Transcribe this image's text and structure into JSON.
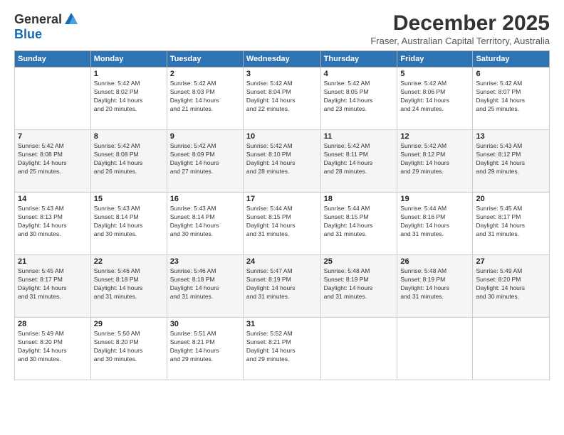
{
  "logo": {
    "general": "General",
    "blue": "Blue"
  },
  "title": "December 2025",
  "subtitle": "Fraser, Australian Capital Territory, Australia",
  "days_of_week": [
    "Sunday",
    "Monday",
    "Tuesday",
    "Wednesday",
    "Thursday",
    "Friday",
    "Saturday"
  ],
  "weeks": [
    [
      {
        "day": "",
        "info": ""
      },
      {
        "day": "1",
        "info": "Sunrise: 5:42 AM\nSunset: 8:02 PM\nDaylight: 14 hours\nand 20 minutes."
      },
      {
        "day": "2",
        "info": "Sunrise: 5:42 AM\nSunset: 8:03 PM\nDaylight: 14 hours\nand 21 minutes."
      },
      {
        "day": "3",
        "info": "Sunrise: 5:42 AM\nSunset: 8:04 PM\nDaylight: 14 hours\nand 22 minutes."
      },
      {
        "day": "4",
        "info": "Sunrise: 5:42 AM\nSunset: 8:05 PM\nDaylight: 14 hours\nand 23 minutes."
      },
      {
        "day": "5",
        "info": "Sunrise: 5:42 AM\nSunset: 8:06 PM\nDaylight: 14 hours\nand 24 minutes."
      },
      {
        "day": "6",
        "info": "Sunrise: 5:42 AM\nSunset: 8:07 PM\nDaylight: 14 hours\nand 25 minutes."
      }
    ],
    [
      {
        "day": "7",
        "info": "Sunrise: 5:42 AM\nSunset: 8:08 PM\nDaylight: 14 hours\nand 25 minutes."
      },
      {
        "day": "8",
        "info": "Sunrise: 5:42 AM\nSunset: 8:08 PM\nDaylight: 14 hours\nand 26 minutes."
      },
      {
        "day": "9",
        "info": "Sunrise: 5:42 AM\nSunset: 8:09 PM\nDaylight: 14 hours\nand 27 minutes."
      },
      {
        "day": "10",
        "info": "Sunrise: 5:42 AM\nSunset: 8:10 PM\nDaylight: 14 hours\nand 28 minutes."
      },
      {
        "day": "11",
        "info": "Sunrise: 5:42 AM\nSunset: 8:11 PM\nDaylight: 14 hours\nand 28 minutes."
      },
      {
        "day": "12",
        "info": "Sunrise: 5:42 AM\nSunset: 8:12 PM\nDaylight: 14 hours\nand 29 minutes."
      },
      {
        "day": "13",
        "info": "Sunrise: 5:43 AM\nSunset: 8:12 PM\nDaylight: 14 hours\nand 29 minutes."
      }
    ],
    [
      {
        "day": "14",
        "info": "Sunrise: 5:43 AM\nSunset: 8:13 PM\nDaylight: 14 hours\nand 30 minutes."
      },
      {
        "day": "15",
        "info": "Sunrise: 5:43 AM\nSunset: 8:14 PM\nDaylight: 14 hours\nand 30 minutes."
      },
      {
        "day": "16",
        "info": "Sunrise: 5:43 AM\nSunset: 8:14 PM\nDaylight: 14 hours\nand 30 minutes."
      },
      {
        "day": "17",
        "info": "Sunrise: 5:44 AM\nSunset: 8:15 PM\nDaylight: 14 hours\nand 31 minutes."
      },
      {
        "day": "18",
        "info": "Sunrise: 5:44 AM\nSunset: 8:15 PM\nDaylight: 14 hours\nand 31 minutes."
      },
      {
        "day": "19",
        "info": "Sunrise: 5:44 AM\nSunset: 8:16 PM\nDaylight: 14 hours\nand 31 minutes."
      },
      {
        "day": "20",
        "info": "Sunrise: 5:45 AM\nSunset: 8:17 PM\nDaylight: 14 hours\nand 31 minutes."
      }
    ],
    [
      {
        "day": "21",
        "info": "Sunrise: 5:45 AM\nSunset: 8:17 PM\nDaylight: 14 hours\nand 31 minutes."
      },
      {
        "day": "22",
        "info": "Sunrise: 5:46 AM\nSunset: 8:18 PM\nDaylight: 14 hours\nand 31 minutes."
      },
      {
        "day": "23",
        "info": "Sunrise: 5:46 AM\nSunset: 8:18 PM\nDaylight: 14 hours\nand 31 minutes."
      },
      {
        "day": "24",
        "info": "Sunrise: 5:47 AM\nSunset: 8:19 PM\nDaylight: 14 hours\nand 31 minutes."
      },
      {
        "day": "25",
        "info": "Sunrise: 5:48 AM\nSunset: 8:19 PM\nDaylight: 14 hours\nand 31 minutes."
      },
      {
        "day": "26",
        "info": "Sunrise: 5:48 AM\nSunset: 8:19 PM\nDaylight: 14 hours\nand 31 minutes."
      },
      {
        "day": "27",
        "info": "Sunrise: 5:49 AM\nSunset: 8:20 PM\nDaylight: 14 hours\nand 30 minutes."
      }
    ],
    [
      {
        "day": "28",
        "info": "Sunrise: 5:49 AM\nSunset: 8:20 PM\nDaylight: 14 hours\nand 30 minutes."
      },
      {
        "day": "29",
        "info": "Sunrise: 5:50 AM\nSunset: 8:20 PM\nDaylight: 14 hours\nand 30 minutes."
      },
      {
        "day": "30",
        "info": "Sunrise: 5:51 AM\nSunset: 8:21 PM\nDaylight: 14 hours\nand 29 minutes."
      },
      {
        "day": "31",
        "info": "Sunrise: 5:52 AM\nSunset: 8:21 PM\nDaylight: 14 hours\nand 29 minutes."
      },
      {
        "day": "",
        "info": ""
      },
      {
        "day": "",
        "info": ""
      },
      {
        "day": "",
        "info": ""
      }
    ]
  ]
}
